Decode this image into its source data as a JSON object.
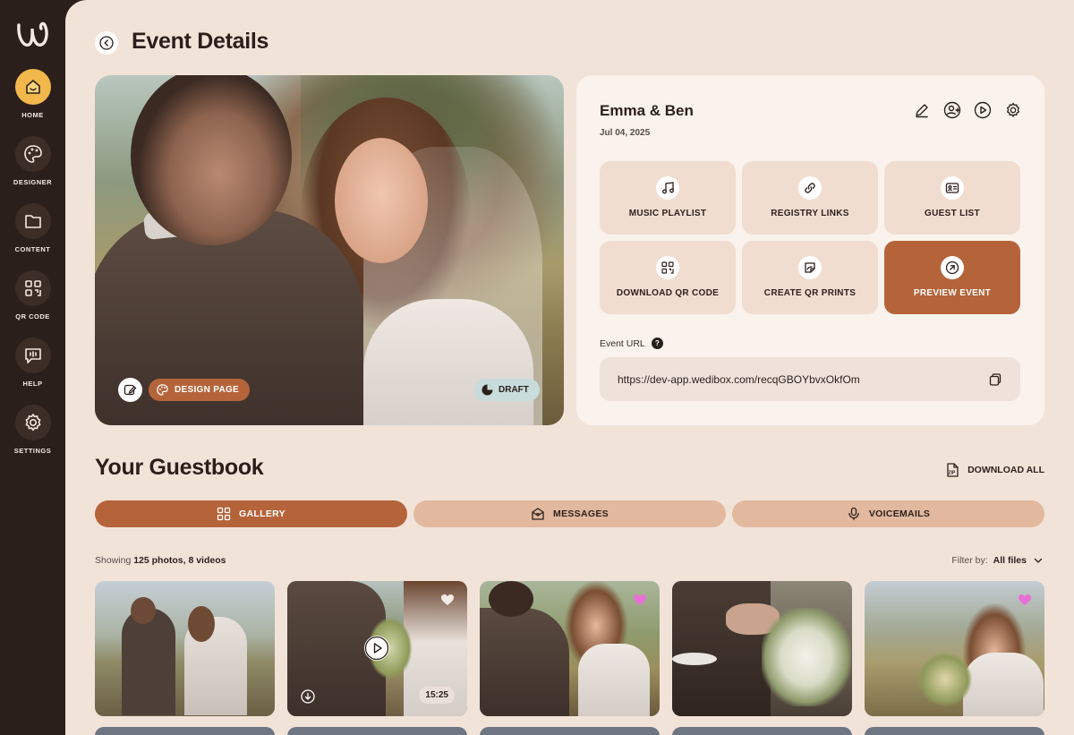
{
  "sidebar": {
    "items": [
      {
        "label": "HOME",
        "icon": "home-icon",
        "active": true
      },
      {
        "label": "DESIGNER",
        "icon": "palette-icon"
      },
      {
        "label": "CONTENT",
        "icon": "folder-icon"
      },
      {
        "label": "QR CODE",
        "icon": "qr-code-icon"
      },
      {
        "label": "HELP",
        "icon": "chat-help-icon"
      },
      {
        "label": "SETTINGS",
        "icon": "gear-icon"
      }
    ]
  },
  "header": {
    "title": "Event Details"
  },
  "hero": {
    "design_label": "DESIGN PAGE",
    "status_label": "DRAFT"
  },
  "event": {
    "name": "Emma & Ben",
    "date": "Jul 04, 2025",
    "actions": [
      "edit-icon",
      "add-user-icon",
      "play-icon",
      "gear-icon"
    ],
    "tiles": [
      {
        "label": "MUSIC PLAYLIST",
        "icon": "music-icon"
      },
      {
        "label": "REGISTRY LINKS",
        "icon": "link-icon"
      },
      {
        "label": "GUEST LIST",
        "icon": "id-card-icon"
      },
      {
        "label": "DOWNLOAD QR CODE",
        "icon": "qr-code-icon"
      },
      {
        "label": "CREATE QR PRINTS",
        "icon": "sticker-icon"
      },
      {
        "label": "PREVIEW EVENT",
        "icon": "arrow-up-right-icon"
      }
    ],
    "url_label": "Event URL",
    "url_help": "?",
    "url": "https://dev-app.wedibox.com/recqGBOYbvxOkfOm"
  },
  "guestbook": {
    "title": "Your Guestbook",
    "download_all": "DOWNLOAD ALL",
    "tabs": [
      {
        "label": "GALLERY",
        "icon": "grid-icon",
        "active": true
      },
      {
        "label": "MESSAGES",
        "icon": "envelope-heart-icon"
      },
      {
        "label": "VOICEMAILS",
        "icon": "microphone-icon"
      }
    ],
    "showing_prefix": "Showing",
    "showing_count": "125 photos, 8 videos",
    "filter_label": "Filter by:",
    "filter_value": "All files",
    "thumbs": [
      {
        "liked": false
      },
      {
        "liked": false,
        "video": true,
        "duration": "15:25"
      },
      {
        "liked": true
      },
      {
        "liked": false
      },
      {
        "liked": true
      }
    ]
  },
  "colors": {
    "sidebar": "#2b1f1b",
    "background": "#f2e3d9",
    "accent": "#b5643a",
    "tab_inactive": "#e2b89e",
    "home_active": "#f2b84b",
    "heart_liked": "#e96fd8"
  }
}
